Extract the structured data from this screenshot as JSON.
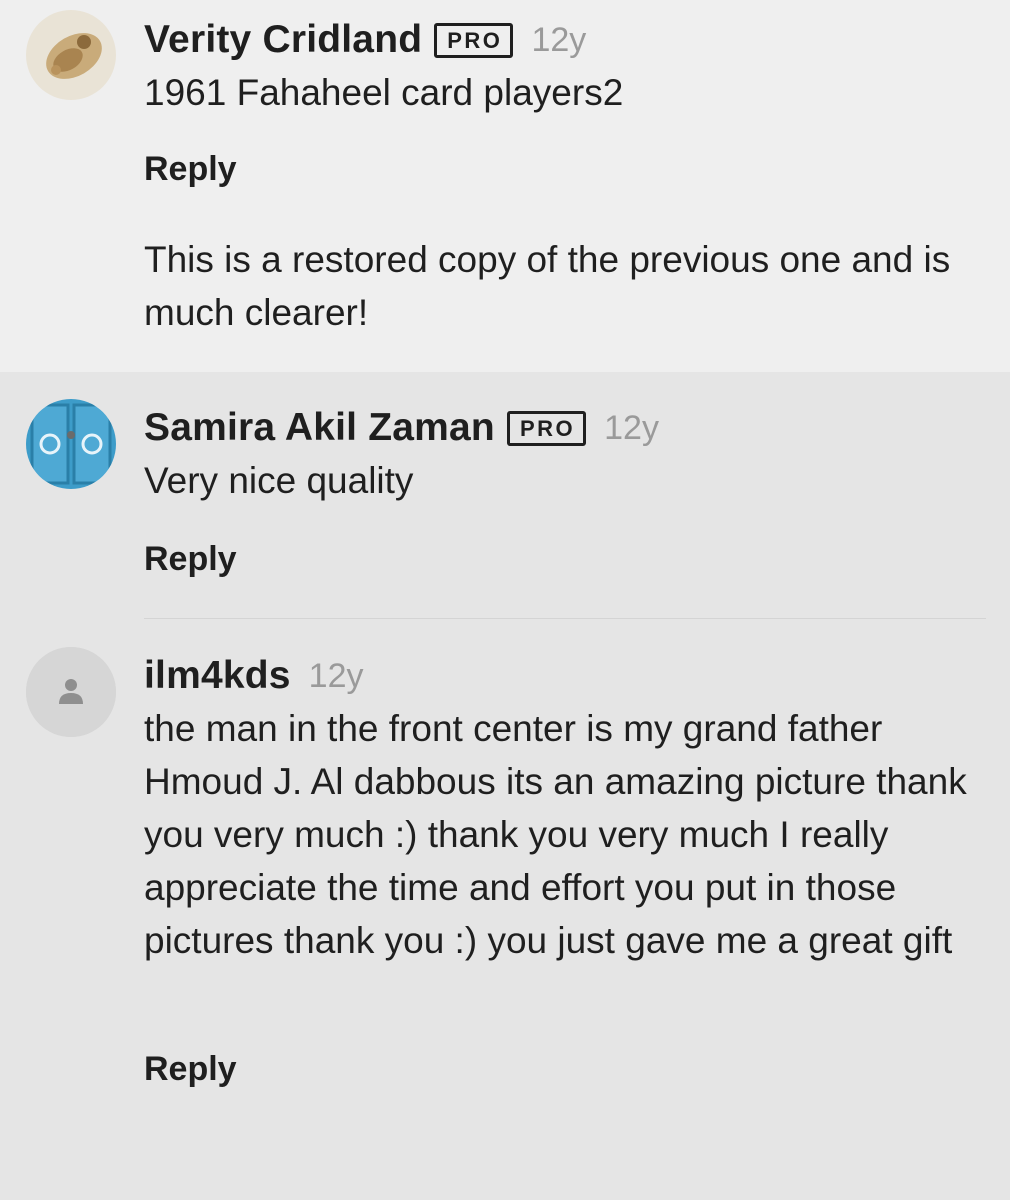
{
  "comments": [
    {
      "author": "Verity Cridland",
      "badge": "PRO",
      "time": "12y",
      "text": "1961 Fahaheel card players2",
      "reply_label": "Reply",
      "reply_text": "This is a restored copy of the previous one and is much clearer!"
    },
    {
      "author": "Samira Akil Zaman",
      "badge": "PRO",
      "time": "12y",
      "text": "Very nice quality",
      "reply_label": "Reply"
    },
    {
      "author": "ilm4kds",
      "time": "12y",
      "text": "the man in the front center is my grand father Hmoud J. Al dabbous its an amazing picture thank you very much :) thank you very much I really appreciate the time and effort you put in those pictures thank you :) you just gave me a great gift",
      "reply_label": "Reply"
    }
  ]
}
